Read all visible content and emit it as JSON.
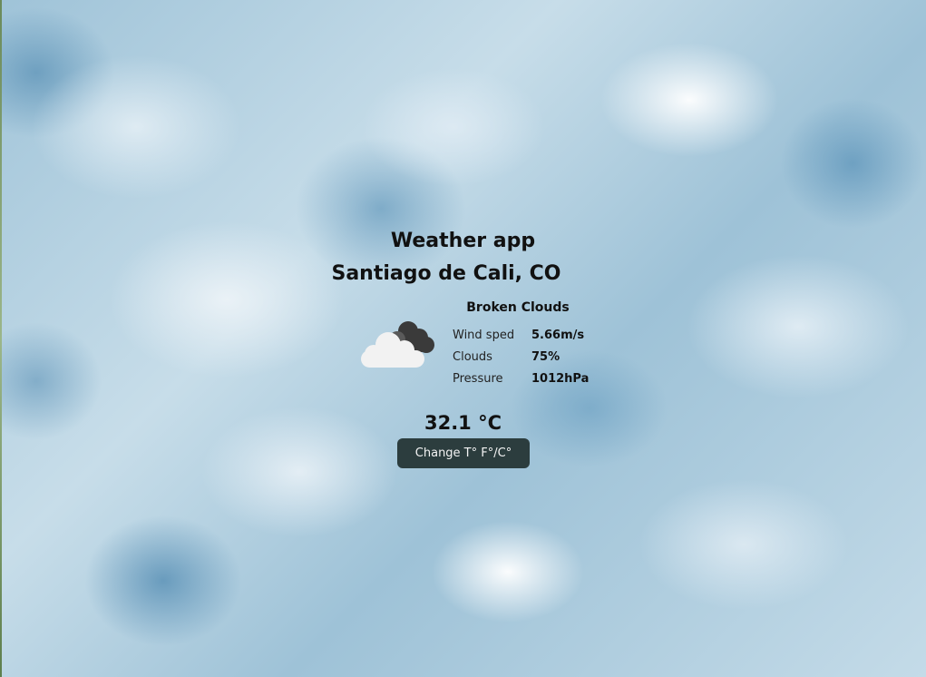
{
  "app": {
    "title": "Weather app",
    "location": "Santiago de Cali, CO"
  },
  "weather": {
    "description": "Broken Clouds",
    "icon": "broken-clouds-icon",
    "stats": [
      {
        "label": "Wind sped",
        "value": "5.66m/s"
      },
      {
        "label": "Clouds",
        "value": "75%"
      },
      {
        "label": "Pressure",
        "value": "1012hPa"
      }
    ],
    "temperature": "32.1 °C"
  },
  "controls": {
    "toggle_label": "Change T° F°/C°"
  },
  "colors": {
    "button_bg": "#2c3d3e",
    "button_text": "#f4f4f4",
    "sky_base": "#a9c9dc"
  }
}
